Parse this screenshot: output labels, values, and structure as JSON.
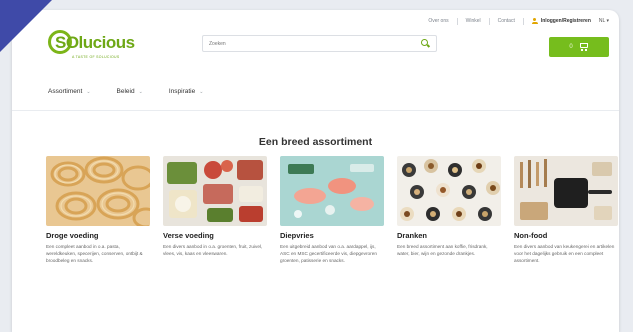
{
  "utility": {
    "links": [
      "Over ons",
      "Winkel",
      "Contact"
    ],
    "user": "Inloggen/Registreren",
    "lang": "NL"
  },
  "logo": {
    "text": "SOlucious",
    "tagline": "A TASTE OF SOLUCIOUS"
  },
  "search": {
    "placeholder": "Zoeken"
  },
  "cart": {
    "count": "0"
  },
  "nav": [
    {
      "label": "Assortiment"
    },
    {
      "label": "Beleid"
    },
    {
      "label": "Inspiratie"
    }
  ],
  "section": {
    "title": "Een breed assortiment"
  },
  "categories": [
    {
      "title": "Droge voeding",
      "text": "Een compleet aanbod in o.a. pasta, wereldkeuken, specerijen, conserven, ontbijt & broodbeleg en snacks.",
      "image": "pasta-photo"
    },
    {
      "title": "Verse voeding",
      "text": "Een divers aanbod in o.a. groenten, fruit, zuivel, vlees, vis, kaas en vleeswaren.",
      "image": "fresh-food-photo"
    },
    {
      "title": "Diepvries",
      "text": "Een uitgebreid aanbod van o.a. aardappel, ijs, ASC en MSC gecertificeerde vis, diepgevroren groenten, patisserie en snacks.",
      "image": "frozen-fish-photo"
    },
    {
      "title": "Dranken",
      "text": "Een breed assortiment aan koffie, frisdrank, water, bier, wijn en gezonde drankjes.",
      "image": "drinks-photo"
    },
    {
      "title": "Non-food",
      "text": "Een divers aanbod van keukengerei en artikelen voor het dagelijks gebruik en een compleet assortiment.",
      "image": "kitchen-tools-photo"
    }
  ],
  "colors": {
    "brand_green": "#76bd1d",
    "corner_mark": "#3f4aa8"
  }
}
